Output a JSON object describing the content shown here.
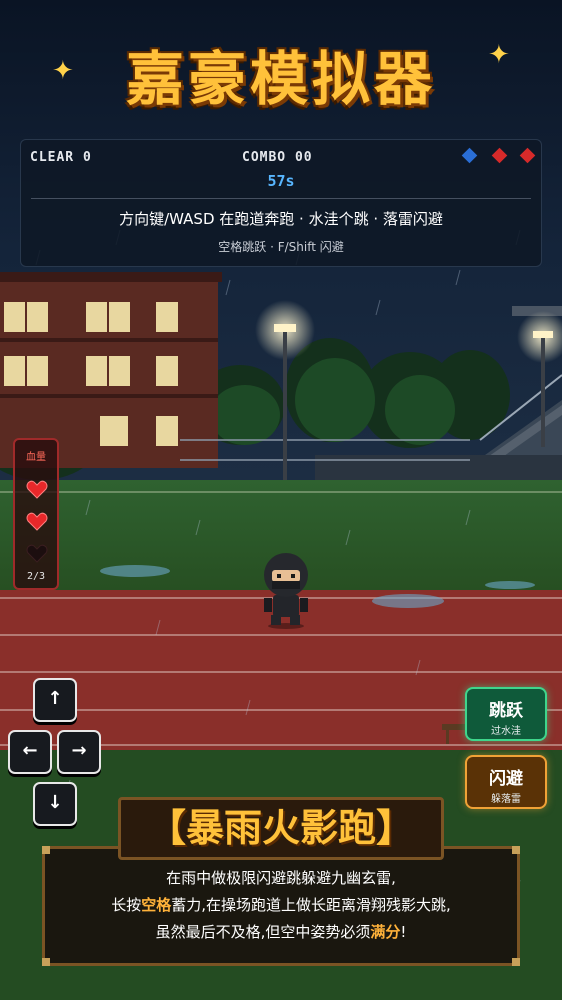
{
  "game": {
    "title": "嘉豪模拟器",
    "stage_name": "暴雨火影跑"
  },
  "hud": {
    "clear_label": "CLEAR 0",
    "combo_label": "COMBO 00",
    "timer": "57s",
    "controls_line1": "方向键/WASD 在跑道奔跑 · 水洼个跳 · 落雷闪避",
    "controls_line2": "空格跳跃 · F/Shift 闪避",
    "gems": [
      {
        "color": "#2a6ed6",
        "state": "blue"
      },
      {
        "color": "#d62a2a",
        "state": "red"
      },
      {
        "color": "#d62a2a",
        "state": "red"
      }
    ]
  },
  "health": {
    "label": "血量",
    "current": 2,
    "max": 3,
    "count_text": "2/3",
    "full_color": "#e8282a",
    "empty_color": "#1c0e0f"
  },
  "dpad": {
    "up": "↑",
    "left": "←",
    "right": "→",
    "down": "↓"
  },
  "actions": {
    "jump": {
      "label": "跳跃",
      "sub": "过水洼"
    },
    "dodge": {
      "label": "闪避",
      "sub": "躲落雷"
    }
  },
  "caption": {
    "banner": "【暴雨火影跑】",
    "line1": "在雨中做极限闪避跳躲避九幽玄雷,",
    "line2_pre": "长按",
    "line2_key": "空格",
    "line2_post": "蓄力,在操场跑道上做长距离滑翔残影大跳,",
    "line3_pre": "虽然最后不及格,但空中姿势必须",
    "line3_key": "满分",
    "line3_post": "!"
  },
  "colors": {
    "title": "#ffc13a",
    "timer": "#58b6ff",
    "highlight": "#ffb23a",
    "track": "#8a2f2a",
    "grass": "#2c5a25"
  }
}
